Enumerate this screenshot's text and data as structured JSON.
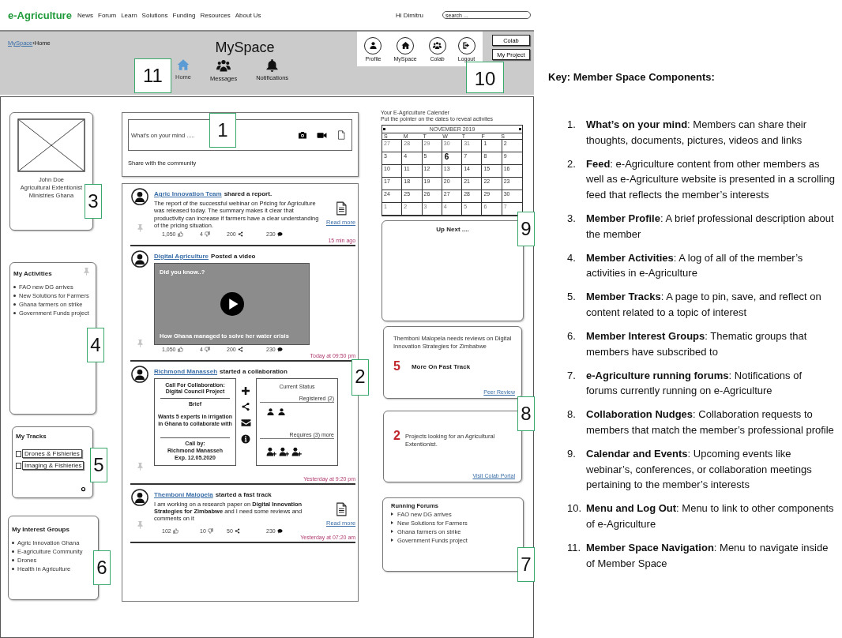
{
  "top_nav": {
    "logo": "e-Agriculture",
    "links": [
      "News",
      "Forum",
      "Learn",
      "Solutions",
      "Funding",
      "Resources",
      "About Us"
    ],
    "greeting": "Hi Dimitru",
    "search": {
      "placeholder": "search ..."
    }
  },
  "header": {
    "breadcrumb": {
      "parent": "MySpace",
      "separator": "›",
      "current": "Home"
    },
    "title": "MySpace",
    "space_nav": [
      {
        "label": "Home",
        "selected": true
      },
      {
        "label": "Messages",
        "selected": false
      },
      {
        "label": "Notifications",
        "selected": false
      }
    ],
    "menu": [
      {
        "label": "Profile"
      },
      {
        "label": "MySpace"
      },
      {
        "label": "Colab"
      },
      {
        "label": "Logout"
      }
    ],
    "buttons": [
      "Colab",
      "My Project"
    ]
  },
  "profile": {
    "name": "John Doe",
    "role": "Agricultural Extentionist",
    "org": "Ministries Ghana"
  },
  "activities": {
    "title": "My Activities",
    "items": [
      "FAO new DG arrives",
      "New Solutions for Farmers",
      "Ghana farmers on strike",
      "Government Funds project"
    ]
  },
  "tracks": {
    "title": "My Tracks",
    "items": [
      {
        "label": "Drones & Fishieries",
        "checked": false
      },
      {
        "label": "Imaging & Fishieries",
        "checked": false
      }
    ]
  },
  "interest_groups": {
    "title": "My Interest Groups",
    "items": [
      "Agric Innovation Ghana",
      "E-agriculture Community",
      "Drones",
      "Health in Agriculture"
    ]
  },
  "composer": {
    "placeholder": "What's on your mind .....",
    "caption": "Share with the community"
  },
  "feed": [
    {
      "kind": "report",
      "author": "Agric Innovation Team",
      "action": "shared a report.",
      "body": "The report of the successful webinar on Pricing for Agriculture was released today. The summary makes it clear that productivity can increase if farmers have a clear understanding of the pricing situation.",
      "link": "Read more",
      "stats": [
        {
          "kind": "likes",
          "count": "1,050"
        },
        {
          "kind": "dislikes",
          "count": "4"
        },
        {
          "kind": "shares",
          "count": "200"
        },
        {
          "kind": "comments",
          "count": "230"
        }
      ],
      "time": "15 min ago"
    },
    {
      "kind": "video",
      "author": "Digital Agriculture",
      "action": "Posted a video",
      "video": {
        "heading": "Did you know..?",
        "caption": "How Ghana managed to solve her water crisis"
      },
      "stats": [
        {
          "kind": "likes",
          "count": "1,050"
        },
        {
          "kind": "dislikes",
          "count": "4"
        },
        {
          "kind": "shares",
          "count": "200"
        },
        {
          "kind": "comments",
          "count": "230"
        }
      ],
      "time": "Today at 09:50 pm"
    },
    {
      "kind": "collaboration",
      "author": "Richmond Manasseh",
      "action": "started a collaboration",
      "call": {
        "title": "Call For Collaboration: Digital Council Project",
        "brief_label": "Brief",
        "brief": "Wants 5 experts in irrigation in Ghana to collaborate with",
        "by": "Call by:",
        "by_name": "Richmond Manasseh",
        "expiry": "Exp. 12.05.2020"
      },
      "status": {
        "title": "Current Status",
        "registered": "Registered (2)",
        "required": "Requires (3) more",
        "slots": [
          {
            "kind": "registered"
          },
          {
            "kind": "registered"
          },
          {
            "kind": "open"
          },
          {
            "kind": "open"
          },
          {
            "kind": "open"
          }
        ]
      },
      "time": "Yesterday at 9:20 pm"
    },
    {
      "kind": "report",
      "author": "Themboni Malopela",
      "action": "started a fast track",
      "body": "I am working on a research paper on **Digital Innovation Strategies for Zimbabwe** and I need some reviews and comments on it",
      "link": "Read more",
      "stats": [
        {
          "kind": "likes",
          "count": "102"
        },
        {
          "kind": "dislikes",
          "count": "10"
        },
        {
          "kind": "shares",
          "count": "50"
        },
        {
          "kind": "comments",
          "count": "230"
        }
      ],
      "time": "Yesterday at 07:20 am"
    }
  ],
  "calendar": {
    "intro": [
      "Your E-Agriculture Calender",
      "Put the pointer on the dates to reveal activites"
    ],
    "month": "NOVEMBER 2019",
    "weekdays": [
      "S",
      "M",
      "T",
      "W",
      "T",
      "F",
      "S"
    ],
    "days": [
      {
        "label": "27",
        "muted": true,
        "selected": false
      },
      {
        "label": "28",
        "muted": true,
        "selected": false
      },
      {
        "label": "29",
        "muted": true,
        "selected": false
      },
      {
        "label": "30",
        "muted": true,
        "selected": false
      },
      {
        "label": "31",
        "muted": true,
        "selected": false
      },
      {
        "label": "1",
        "muted": false,
        "selected": false
      },
      {
        "label": "2",
        "muted": false,
        "selected": false
      },
      {
        "label": "3",
        "muted": false,
        "selected": false
      },
      {
        "label": "4",
        "muted": false,
        "selected": false
      },
      {
        "label": "5",
        "muted": false,
        "selected": false
      },
      {
        "label": "6",
        "muted": false,
        "selected": true
      },
      {
        "label": "7",
        "muted": false,
        "selected": false
      },
      {
        "label": "8",
        "muted": false,
        "selected": false
      },
      {
        "label": "9",
        "muted": false,
        "selected": false
      },
      {
        "label": "10",
        "muted": false,
        "selected": false
      },
      {
        "label": "11",
        "muted": false,
        "selected": false
      },
      {
        "label": "12",
        "muted": false,
        "selected": false
      },
      {
        "label": "13",
        "muted": false,
        "selected": false
      },
      {
        "label": "14",
        "muted": false,
        "selected": false
      },
      {
        "label": "15",
        "muted": false,
        "selected": false
      },
      {
        "label": "16",
        "muted": false,
        "selected": false
      },
      {
        "label": "17",
        "muted": false,
        "selected": false
      },
      {
        "label": "18",
        "muted": false,
        "selected": false
      },
      {
        "label": "19",
        "muted": false,
        "selected": false
      },
      {
        "label": "20",
        "muted": false,
        "selected": false
      },
      {
        "label": "21",
        "muted": false,
        "selected": false
      },
      {
        "label": "22",
        "muted": false,
        "selected": false
      },
      {
        "label": "23",
        "muted": false,
        "selected": false
      },
      {
        "label": "24",
        "muted": false,
        "selected": false
      },
      {
        "label": "25",
        "muted": false,
        "selected": false
      },
      {
        "label": "26",
        "muted": false,
        "selected": false
      },
      {
        "label": "27",
        "muted": false,
        "selected": false
      },
      {
        "label": "28",
        "muted": false,
        "selected": false
      },
      {
        "label": "29",
        "muted": false,
        "selected": false
      },
      {
        "label": "30",
        "muted": false,
        "selected": false
      },
      {
        "label": "1",
        "muted": true,
        "selected": false
      },
      {
        "label": "2",
        "muted": true,
        "selected": false
      },
      {
        "label": "3",
        "muted": true,
        "selected": false
      },
      {
        "label": "4",
        "muted": true,
        "selected": false
      },
      {
        "label": "5",
        "muted": true,
        "selected": false
      },
      {
        "label": "6",
        "muted": true,
        "selected": false
      },
      {
        "label": "7",
        "muted": true,
        "selected": false
      }
    ]
  },
  "up_next": {
    "title": "Up Next ...."
  },
  "nudges": [
    {
      "kind": "fast_track",
      "text": "Themboni Malopela needs reviews on Digital Innovation Strategies for Zimbabwe",
      "count": "5",
      "label": "More On Fast Track",
      "link": "Peer Review"
    },
    {
      "kind": "projects",
      "count": "2",
      "text": "Projects looking for an Agricultural Extentionist.",
      "link": "Visit Colab Portal"
    }
  ],
  "forums": {
    "title": "Running Forums",
    "items": [
      "FAO new DG arrives",
      "New Solutions for Farmers",
      "Ghana farmers on strike",
      "Government Funds project"
    ]
  },
  "annotations": [
    {
      "label": "11"
    },
    {
      "label": "10"
    },
    {
      "label": "1"
    },
    {
      "label": "3"
    },
    {
      "label": "9"
    },
    {
      "label": "4"
    },
    {
      "label": "2"
    },
    {
      "label": "8"
    },
    {
      "label": "5"
    },
    {
      "label": "6"
    },
    {
      "label": "7"
    }
  ],
  "key": {
    "title": "Key: Member Space Components:",
    "items": [
      {
        "number": "1.",
        "text": "**What’s on your mind**: Members can share their thoughts, documents, pictures, videos and links"
      },
      {
        "number": "2.",
        "text": "**Feed**: e-Agriculture content from other members as well as e-Agriculture website is presented in a scrolling feed that reflects the member’s interests"
      },
      {
        "number": "3.",
        "text": "**Member Profile**: A brief professional description about the member"
      },
      {
        "number": "4.",
        "text": "**Member Activities**: A log of all of the member’s activities in e-Agriculture"
      },
      {
        "number": "5.",
        "text": "**Member Tracks**: A page to pin, save, and reflect on content related to a topic of interest"
      },
      {
        "number": "6.",
        "text": "**Member Interest Groups**: Thematic groups that members have subscribed to"
      },
      {
        "number": "7.",
        "text": "**e-Agriculture running forums**: Notifications of forums currently running on e-Agriculture"
      },
      {
        "number": "8.",
        "text": "**Collaboration Nudges**: Collaboration requests to members that match the member’s professional profile"
      },
      {
        "number": "9.",
        "text": "**Calendar and Events**: Upcoming events like webinar’s, conferences, or collaboration meetings pertaining to the member’s interests"
      },
      {
        "number": "10.",
        "text": "**Menu and Log Out**: Menu to link to other components of e-Agriculture"
      },
      {
        "number": "11.",
        "text": "**Member Space Navigation**: Menu to navigate inside of Member Space"
      }
    ]
  }
}
